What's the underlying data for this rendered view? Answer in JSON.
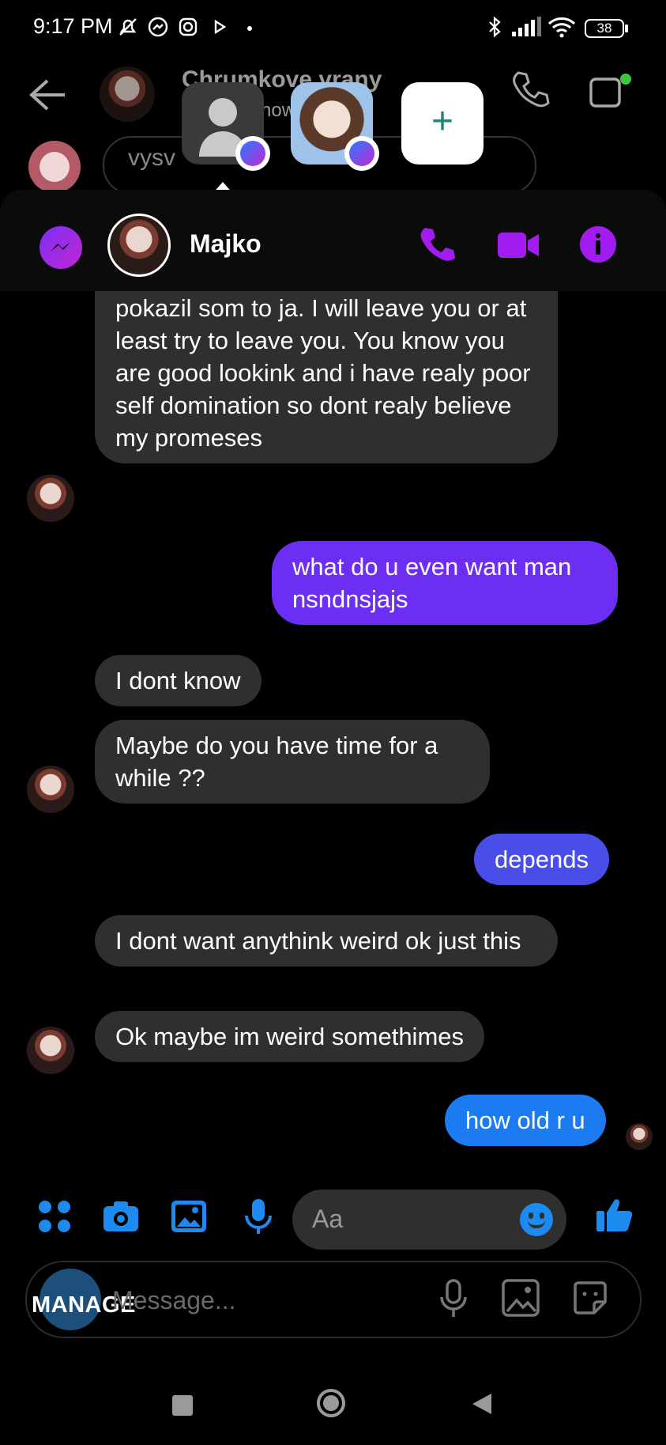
{
  "status_bar": {
    "time": "9:17 PM",
    "battery": "38",
    "icons": [
      "mute-icon",
      "messenger-icon",
      "instagram-icon",
      "play-icon",
      "dot-icon",
      "bluetooth-icon",
      "signal-icon",
      "wifi-icon",
      "battery-icon"
    ]
  },
  "background_chat": {
    "title": "Chrumkove vrany",
    "subtitle": "now",
    "input_text": "vysv"
  },
  "bubble_header": {
    "contact_name": "Majko",
    "add_label": "+"
  },
  "messages": [
    {
      "side": "in",
      "text": "slovo a dnes som bol sentimentalny ok pokazil som to ja. I will leave you or at least try to leave you. You know you are good lookink and i have realy poor self domination so dont realy believe my promeses"
    },
    {
      "side": "out",
      "text": "what do u even want man nsndnsjajs"
    },
    {
      "side": "in",
      "text": "I dont know"
    },
    {
      "side": "in",
      "text": "Maybe do you have time for a while ??"
    },
    {
      "side": "out",
      "text": "depends"
    },
    {
      "side": "in",
      "text": "I dont want anythink weird ok just this"
    },
    {
      "side": "in",
      "text": "Ok maybe im weird somethimes"
    },
    {
      "side": "out",
      "text": "how old r u"
    }
  ],
  "composer": {
    "placeholder": "Aa"
  },
  "background_composer": {
    "manage_label": "MANAGE",
    "placeholder": "Message..."
  },
  "colors": {
    "purple": "#a21cf2",
    "bubble_purple": "#6c2ef2",
    "bubble_indigo": "#4a4ee8",
    "bubble_blue": "#1c7bf0",
    "incoming": "#2f2f2f",
    "composer_blue": "#1c8aef"
  }
}
